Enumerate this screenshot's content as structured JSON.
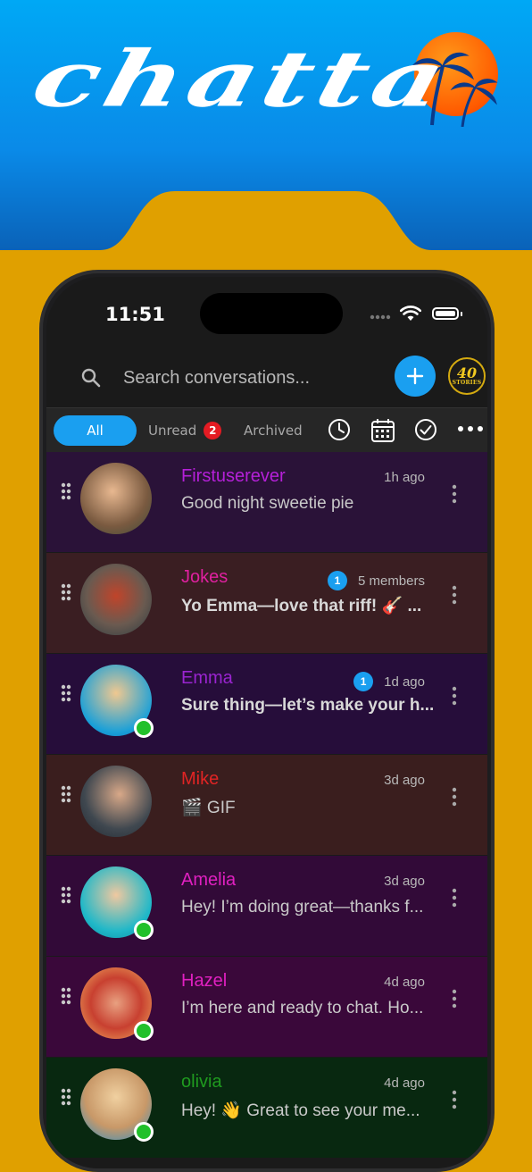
{
  "app": {
    "logo_text": "chatta"
  },
  "status_bar": {
    "time": "11:51"
  },
  "search": {
    "placeholder": "Search conversations..."
  },
  "header": {
    "stories_number": "40",
    "stories_label": "STORIES"
  },
  "tabs": {
    "all": "All",
    "unread": "Unread",
    "unread_count": "2",
    "archived": "Archived"
  },
  "colors": {
    "accent": "#1a9ff0",
    "hero_blue": "#0a8ae8",
    "frame_gold": "#e0a000",
    "badge_red": "#e41b23",
    "online_green": "#21c02b"
  },
  "conversations": [
    {
      "name": "Firstuserever",
      "time": "1h ago",
      "preview": "Good night sweetie pie",
      "name_color": "#b520d8",
      "row_bg": "#2a1238",
      "online": false,
      "unread": ""
    },
    {
      "name": "Jokes",
      "time": "5 members",
      "preview": "Yo Emma—love that riff! 🎸 ...",
      "name_color": "#e020a0",
      "row_bg": "#3a1e22",
      "online": false,
      "unread": "1"
    },
    {
      "name": "Emma",
      "time": "1d ago",
      "preview": "Sure thing—let’s make your h...",
      "name_color": "#9a24d0",
      "row_bg": "#260d3a",
      "online": true,
      "unread": "1"
    },
    {
      "name": "Mike",
      "time": "3d ago",
      "preview": "🎬 GIF",
      "name_color": "#e02424",
      "row_bg": "#3a1e1e",
      "online": false,
      "unread": ""
    },
    {
      "name": "Amelia",
      "time": "3d ago",
      "preview": "Hey! I’m doing great—thanks f...",
      "name_color": "#e020c0",
      "row_bg": "#320a38",
      "online": true,
      "unread": ""
    },
    {
      "name": "Hazel",
      "time": "4d ago",
      "preview": "I’m here and ready to chat. Ho...",
      "name_color": "#e020c0",
      "row_bg": "#3a083a",
      "online": true,
      "unread": ""
    },
    {
      "name": "olivia",
      "time": "4d ago",
      "preview": "Hey! 👋 Great to see your me...",
      "name_color": "#1f9a1f",
      "row_bg": "#082810",
      "online": true,
      "unread": ""
    }
  ]
}
